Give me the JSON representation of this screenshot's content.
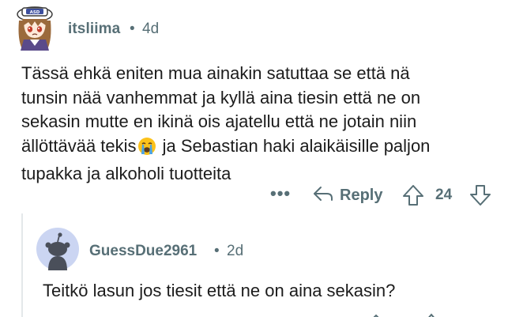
{
  "top_comment": {
    "author": "itsliima",
    "separator": "•",
    "age": "4d",
    "avatar": {
      "icon": "anime-girl-avatar-icon",
      "badge_text": "ASD"
    },
    "body_lines": [
      "Tässä ehkä eniten mua ainakin satuttaa se että nä",
      "tunsin nää vanhemmat ja kyllä aina tiesin että ne on",
      "sekasin mutte en ikinä ois ajatellu että ne jotain niin",
      "ällöttävää tekis",
      " ja Sebastian haki alaikäisille paljon",
      "tupakka ja alkoholi tuotteita"
    ],
    "emoji": "loudly-crying-face-icon",
    "actions": {
      "more": "•••",
      "reply_label": "Reply",
      "score": "24"
    }
  },
  "reply_comment": {
    "author": "GuessDue2961",
    "separator": "•",
    "age": "2d",
    "avatar": {
      "icon": "snoo-default-avatar-icon"
    },
    "body": "Teitkö lasun jos tiesit että ne on aina sekasin?"
  },
  "colors": {
    "meta_gray": "#576f76",
    "text": "#1c1c1c",
    "snoo_bg": "#cbd5f2",
    "thread_line": "#e4e8ea"
  }
}
